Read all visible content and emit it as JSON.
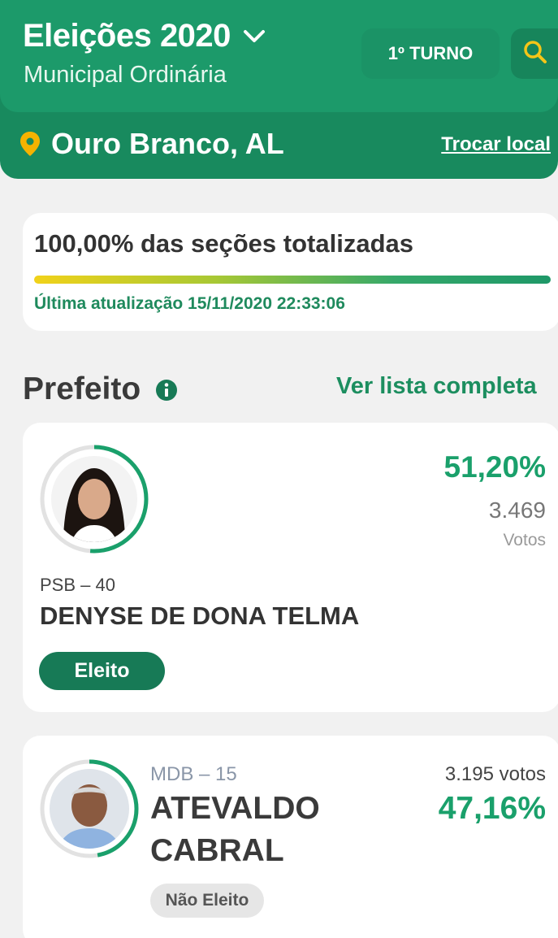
{
  "header": {
    "title": "Eleições 2020",
    "subtitle": "Municipal Ordinária",
    "turno_label": "1º TURNO",
    "location": "Ouro Branco, AL",
    "change_location": "Trocar local"
  },
  "status": {
    "title": "100,00% das seções totalizadas",
    "progress": 1.0,
    "last_update": "Última atualização 15/11/2020 22:33:06"
  },
  "section": {
    "title": "Prefeito",
    "see_all": "Ver lista completa"
  },
  "candidates": [
    {
      "party": "PSB – 40",
      "name": "DENYSE DE DONA TELMA",
      "percent": "51,20%",
      "votes": "3.469",
      "votes_label": "Votos",
      "status": "Eleito",
      "ring_fraction": 0.512
    },
    {
      "party": "MDB – 15",
      "name_line1": "ATEVALDO",
      "name_line2": "CABRAL",
      "votes_text": "3.195 votos",
      "percent": "47,16%",
      "status": "Não Eleito",
      "ring_fraction": 0.4716
    }
  ],
  "colors": {
    "brand_green": "#1c9a6a",
    "accent_green": "#1aa06b",
    "pin_yellow": "#f5b301"
  }
}
